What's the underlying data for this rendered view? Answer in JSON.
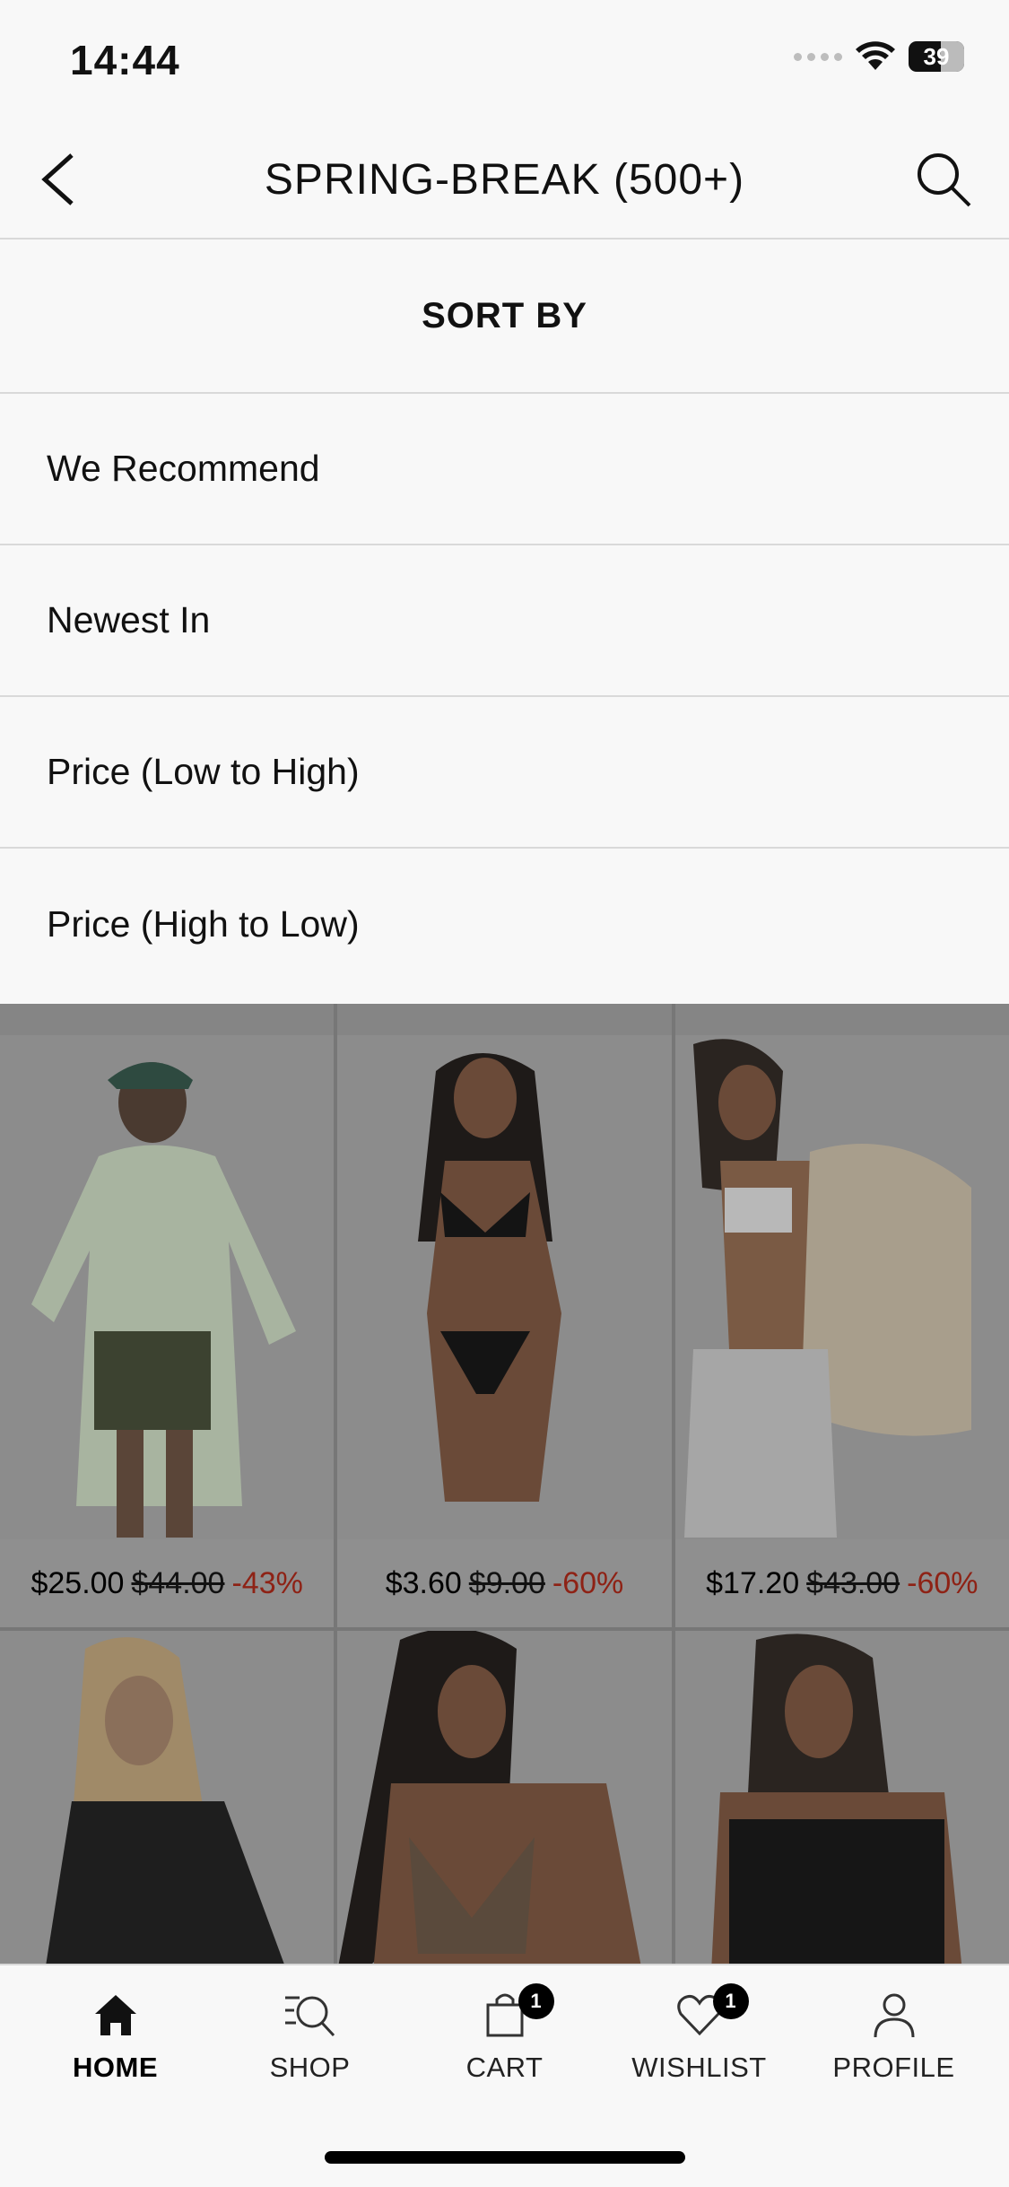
{
  "status_bar": {
    "time": "14:44",
    "battery": "39"
  },
  "header": {
    "title": "SPRING-BREAK (500+)"
  },
  "sort": {
    "heading": "SORT BY",
    "options": [
      "We Recommend",
      "Newest In",
      "Price (Low to High)",
      "Price (High to Low)"
    ]
  },
  "products": [
    {
      "price": "$25.00",
      "original": "$44.00",
      "discount": "-43%"
    },
    {
      "price": "$3.60",
      "original": "$9.00",
      "discount": "-60%"
    },
    {
      "price": "$17.20",
      "original": "$43.00",
      "discount": "-60%"
    }
  ],
  "nav": {
    "items": [
      {
        "label": "HOME",
        "icon": "home-icon"
      },
      {
        "label": "SHOP",
        "icon": "shop-search-icon"
      },
      {
        "label": "CART",
        "icon": "bag-icon",
        "badge": "1"
      },
      {
        "label": "WISHLIST",
        "icon": "heart-icon",
        "badge": "1"
      },
      {
        "label": "PROFILE",
        "icon": "person-icon"
      }
    ]
  },
  "colors": {
    "discount": "#c0392b",
    "overlay": "rgba(0,0,0,0.4)",
    "background": "#f8f8f8"
  }
}
